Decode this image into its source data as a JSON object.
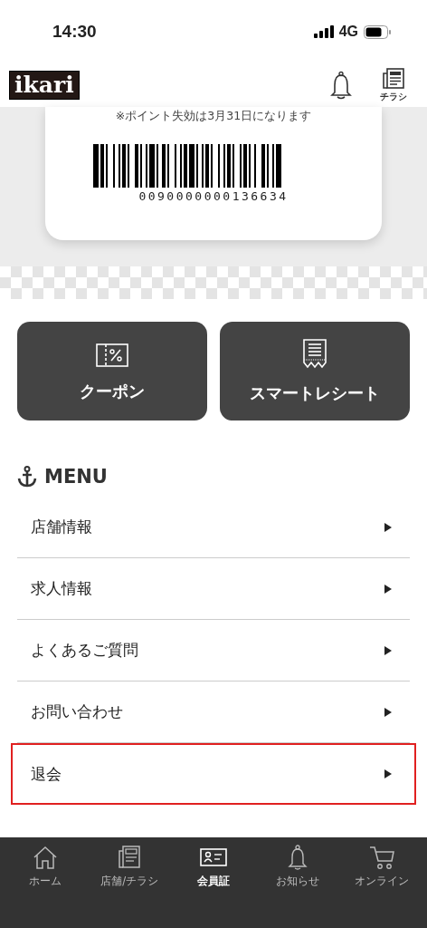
{
  "status_bar": {
    "time": "14:30",
    "network": "4G"
  },
  "header": {
    "logo": "ikari",
    "flyer_label": "チラシ"
  },
  "member_card": {
    "notice": "※ポイント失効は3月31日になります",
    "barcode_number": "0090000000136634"
  },
  "shortcuts": [
    {
      "kind": "coupon",
      "label": "クーポン"
    },
    {
      "kind": "receipt",
      "label": "スマートレシート"
    }
  ],
  "menu": {
    "title": "MENU",
    "items": [
      {
        "label": "店舗情報",
        "highlighted": false
      },
      {
        "label": "求人情報",
        "highlighted": false
      },
      {
        "label": "よくあるご質問",
        "highlighted": false
      },
      {
        "label": "お問い合わせ",
        "highlighted": false
      },
      {
        "label": "退会",
        "highlighted": true
      }
    ]
  },
  "tab_bar": [
    {
      "kind": "home",
      "label": "ホーム",
      "selected": false
    },
    {
      "kind": "flyer",
      "label": "店舗/チラシ",
      "selected": false
    },
    {
      "kind": "card",
      "label": "会員証",
      "selected": true
    },
    {
      "kind": "bell",
      "label": "お知らせ",
      "selected": false
    },
    {
      "kind": "cart",
      "label": "オンライン",
      "selected": false
    }
  ]
}
